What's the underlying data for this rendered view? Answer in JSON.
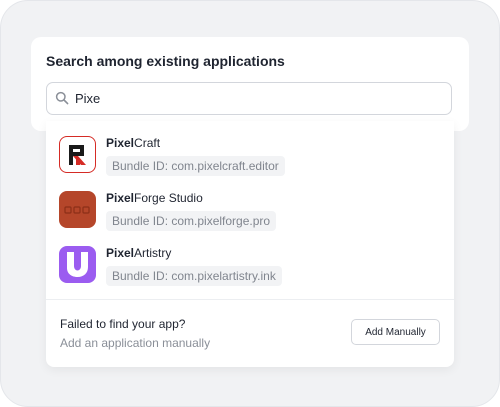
{
  "search": {
    "title": "Search among existing applications",
    "query": "Pixe",
    "icon": "search-icon"
  },
  "results": [
    {
      "match": "Pixel",
      "rest": "Craft",
      "bundle": "Bundle ID: com.pixelcraft.editor",
      "icon": "pixelcraft-logo-icon"
    },
    {
      "match": "Pixel",
      "rest": "Forge Studio",
      "bundle": "Bundle ID: com.pixelforge.pro",
      "icon": "pixelforge-logo-icon"
    },
    {
      "match": "Pixel",
      "rest": "Artistry",
      "bundle": "Bundle ID: com.pixelartistry.ink",
      "icon": "pixelartistry-logo-icon"
    }
  ],
  "fallback": {
    "title": "Failed to find your app?",
    "subtitle": "Add an application manually",
    "button_label": "Add Manually"
  },
  "colors": {
    "frame_background": "#f1f2f4",
    "pixelcraft_red": "#d52b25",
    "pixelforge_brown": "#b5462a",
    "pixelartistry_purple": "#9b5cf0"
  }
}
